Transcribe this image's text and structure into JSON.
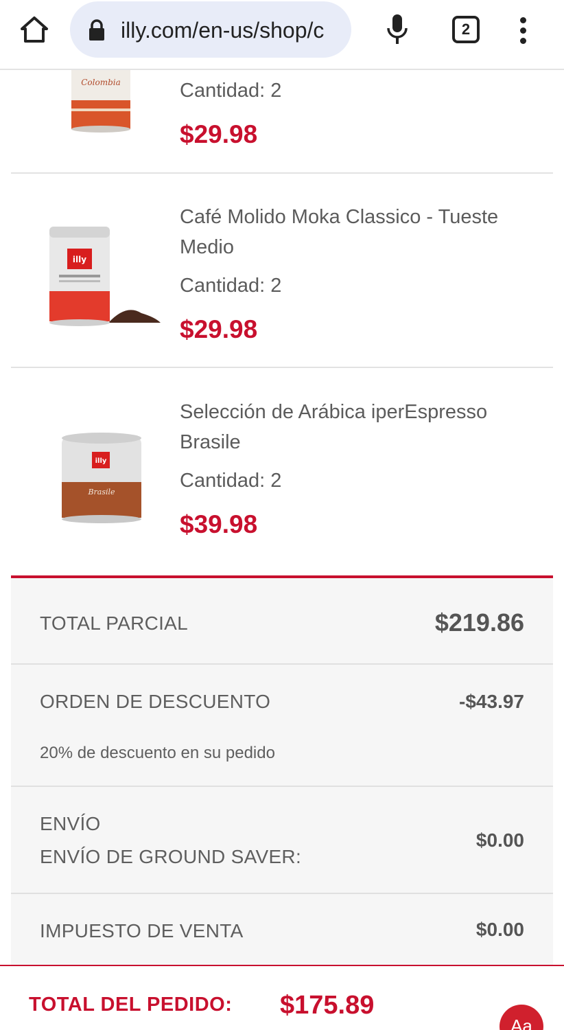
{
  "browser": {
    "url": "illy.com/en-us/shop/c",
    "tab_count": "2",
    "icons": [
      "home-icon",
      "lock-icon",
      "microphone-icon",
      "tab-switcher-icon",
      "more-vert-icon"
    ]
  },
  "cart": {
    "items": [
      {
        "name": "",
        "quantity": "Cantidad: 2",
        "price": "$29.98",
        "image": "can-colombia-icon"
      },
      {
        "name": "Café Molido Moka Classico - Tueste Medio",
        "quantity": "Cantidad: 2",
        "price": "$29.98",
        "image": "can-moka-classico-icon"
      },
      {
        "name": "Selección de Arábica iperEspresso Brasile",
        "quantity": "Cantidad: 2",
        "price": "$39.98",
        "image": "can-iperespresso-brasile-icon"
      }
    ]
  },
  "summary": {
    "subtotal_label": "TOTAL PARCIAL",
    "subtotal_value": "$219.86",
    "discount_label": "ORDEN DE DESCUENTO",
    "discount_value": "-$43.97",
    "discount_note": "20% de descuento en su pedido",
    "shipping_label": "ENVÍO",
    "shipping_method": "ENVÍO DE GROUND SAVER:",
    "shipping_value": "$0.00",
    "tax_label": "IMPUESTO DE VENTA",
    "tax_value": "$0.00"
  },
  "footer": {
    "total_label": "TOTAL DEL PEDIDO:",
    "total_value": "$175.89",
    "accessibility_label": "Aa"
  },
  "colors": {
    "brand_red": "#c8102e",
    "url_bar_bg": "#e8ecf8",
    "summary_bg": "#f6f6f6"
  }
}
